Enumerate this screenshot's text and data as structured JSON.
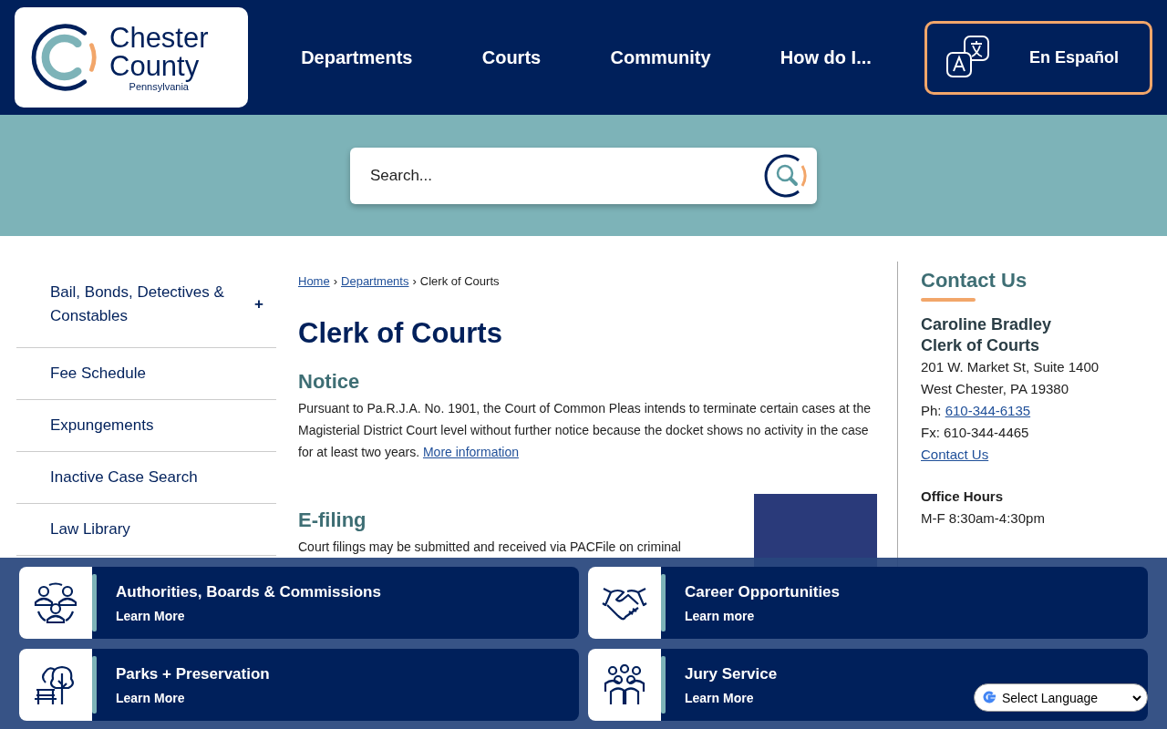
{
  "header": {
    "logo": {
      "line1": "Chester",
      "line2": "County",
      "line3": "Pennsylvania"
    },
    "nav": [
      "Departments",
      "Courts",
      "Community",
      "How do I..."
    ],
    "language_button": "En Español"
  },
  "search": {
    "placeholder": "Search..."
  },
  "sidebar": {
    "items": [
      {
        "label": "Bail, Bonds, Detectives & Constables",
        "toggle": "+"
      },
      {
        "label": "Fee Schedule"
      },
      {
        "label": "Expungements"
      },
      {
        "label": "Inactive Case Search"
      },
      {
        "label": "Law Library"
      }
    ]
  },
  "breadcrumb": {
    "separator": "›",
    "items": [
      {
        "label": "Home",
        "link": true
      },
      {
        "label": "Departments",
        "link": true
      },
      {
        "label": "Clerk of Courts",
        "link": false
      }
    ]
  },
  "page_title": "Clerk of Courts",
  "sections": [
    {
      "heading": "Notice",
      "text": "Pursuant to Pa.R.J.A. No. 1901, the Court of Common Pleas intends to terminate certain cases at the Magisterial District Court level without further notice because the docket shows no activity in the case for at least two years.",
      "link": "More information"
    },
    {
      "heading": "E-filing",
      "text": "Court filings may be submitted and received via PACFile on criminal"
    }
  ],
  "contact": {
    "heading": "Contact Us",
    "name": "Caroline Bradley",
    "role": "Clerk of Courts",
    "address": [
      "201 W. Market St, Suite 1400",
      "West Chester, PA 19380"
    ],
    "phone_label": "Ph:",
    "phone": "610-344-6135",
    "fax": "Fx: 610-344-4465",
    "link": "Contact Us",
    "hours_heading": "Office Hours",
    "hours": "M-F 8:30am-4:30pm"
  },
  "quick_links": [
    {
      "kind": "people",
      "title": "Authorities, Boards & Commissions",
      "action": "Learn More"
    },
    {
      "kind": "handshake",
      "title": "Career Opportunities",
      "action": "Learn more"
    },
    {
      "kind": "park",
      "title": "Parks + Preservation",
      "action": "Learn More"
    },
    {
      "kind": "group",
      "title": "Jury Service",
      "action": "Learn More"
    }
  ],
  "translate": {
    "label": "Select Language"
  }
}
